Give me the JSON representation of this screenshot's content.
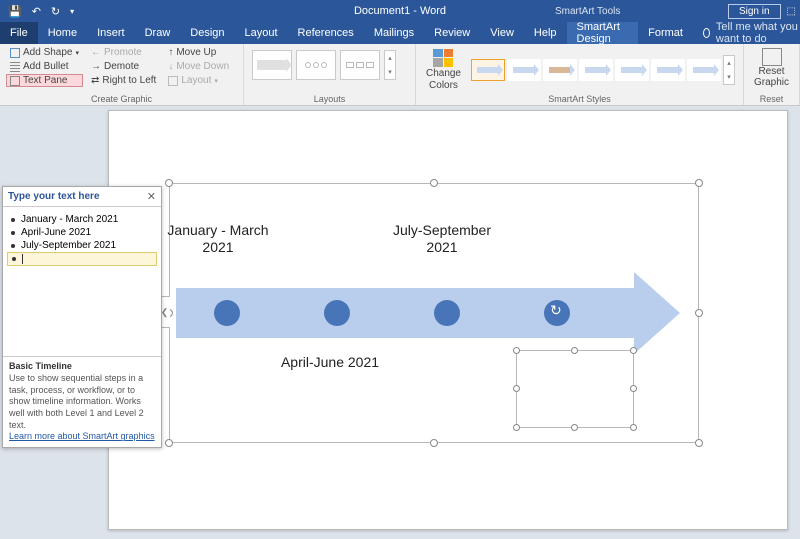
{
  "titlebar": {
    "doc_title": "Document1 - Word",
    "tool_context": "SmartArt Tools",
    "signin": "Sign in"
  },
  "tabs": {
    "file": "File",
    "home": "Home",
    "insert": "Insert",
    "draw": "Draw",
    "design": "Design",
    "layout": "Layout",
    "references": "References",
    "mailings": "Mailings",
    "review": "Review",
    "view": "View",
    "help": "Help",
    "smartart_design": "SmartArt Design",
    "format": "Format",
    "tellme": "Tell me what you want to do"
  },
  "ribbon": {
    "create_graphic": {
      "label": "Create Graphic",
      "add_shape": "Add Shape",
      "add_bullet": "Add Bullet",
      "text_pane": "Text Pane",
      "promote": "Promote",
      "demote": "Demote",
      "rtl": "Right to Left",
      "move_up": "Move Up",
      "move_down": "Move Down",
      "layout_btn": "Layout"
    },
    "layouts": {
      "label": "Layouts"
    },
    "change_colors": {
      "label1": "Change",
      "label2": "Colors"
    },
    "styles": {
      "label": "SmartArt Styles"
    },
    "reset": {
      "label1": "Reset",
      "label2": "Graphic",
      "group": "Reset"
    }
  },
  "textpane": {
    "title": "Type your text here",
    "items": [
      "January - March 2021",
      "April-June 2021",
      "July-September 2021"
    ],
    "footer_heading": "Basic Timeline",
    "footer_text": "Use to show sequential steps in a task, process, or workflow, or to show timeline information. Works well with both Level 1 and Level 2 text.",
    "footer_link": "Learn more about SmartArt graphics"
  },
  "timeline": {
    "label1": "January - March 2021",
    "label2": "April-June 2021",
    "label3": "July-September 2021"
  }
}
